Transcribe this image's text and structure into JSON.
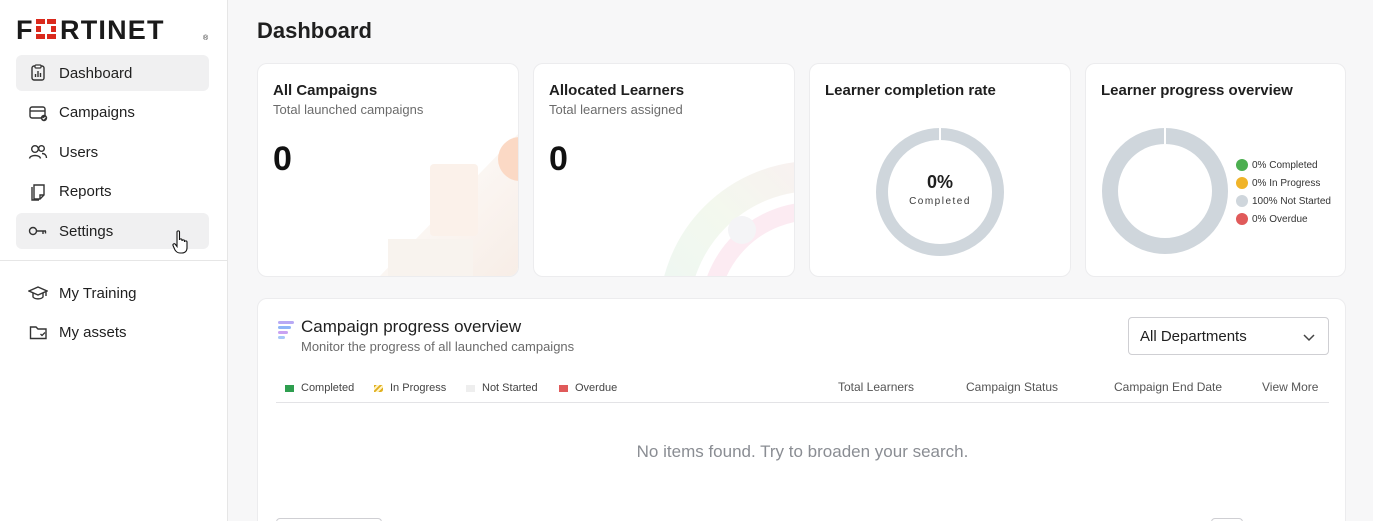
{
  "brand": {
    "logo_text": "FORTINET"
  },
  "sidebar": {
    "items": [
      {
        "label": "Dashboard",
        "icon": "dashboard-icon"
      },
      {
        "label": "Campaigns",
        "icon": "campaigns-icon"
      },
      {
        "label": "Users",
        "icon": "users-icon"
      },
      {
        "label": "Reports",
        "icon": "reports-icon"
      },
      {
        "label": "Settings",
        "icon": "key-icon"
      }
    ],
    "secondary": [
      {
        "label": "My Training",
        "icon": "graduation-cap-icon"
      },
      {
        "label": "My assets",
        "icon": "folder-icon"
      }
    ]
  },
  "page": {
    "title": "Dashboard"
  },
  "cards": {
    "campaigns": {
      "title": "All Campaigns",
      "subtitle": "Total launched campaigns",
      "value": "0"
    },
    "learners": {
      "title": "Allocated Learners",
      "subtitle": "Total learners assigned",
      "value": "0"
    },
    "completion": {
      "title": "Learner completion rate",
      "percent": "0%",
      "label": "Completed"
    },
    "progress": {
      "title": "Learner progress overview",
      "legend": [
        {
          "label": "0% Completed",
          "color": "#4caf50"
        },
        {
          "label": "0% In Progress",
          "color": "#f0b429"
        },
        {
          "label": "100% Not Started",
          "color": "#cfd6dc"
        },
        {
          "label": "0% Overdue",
          "color": "#e05a5a"
        }
      ]
    }
  },
  "overview": {
    "title": "Campaign progress overview",
    "subtitle": "Monitor the progress of all launched campaigns",
    "dept_select": "All Departments",
    "legend": [
      {
        "label": "Completed",
        "color": "#2e9e4f"
      },
      {
        "label": "In Progress",
        "color": "#e0b020"
      },
      {
        "label": "Not Started",
        "color": "#eeeeee"
      },
      {
        "label": "Overdue",
        "color": "#e05a5a"
      }
    ],
    "columns": [
      "Total Learners",
      "Campaign Status",
      "Campaign End Date",
      "View More"
    ],
    "empty_text": "No items found. Try to broaden your search."
  },
  "colors": {
    "accent": "#da291c",
    "donut_track": "#cfd6dc"
  }
}
